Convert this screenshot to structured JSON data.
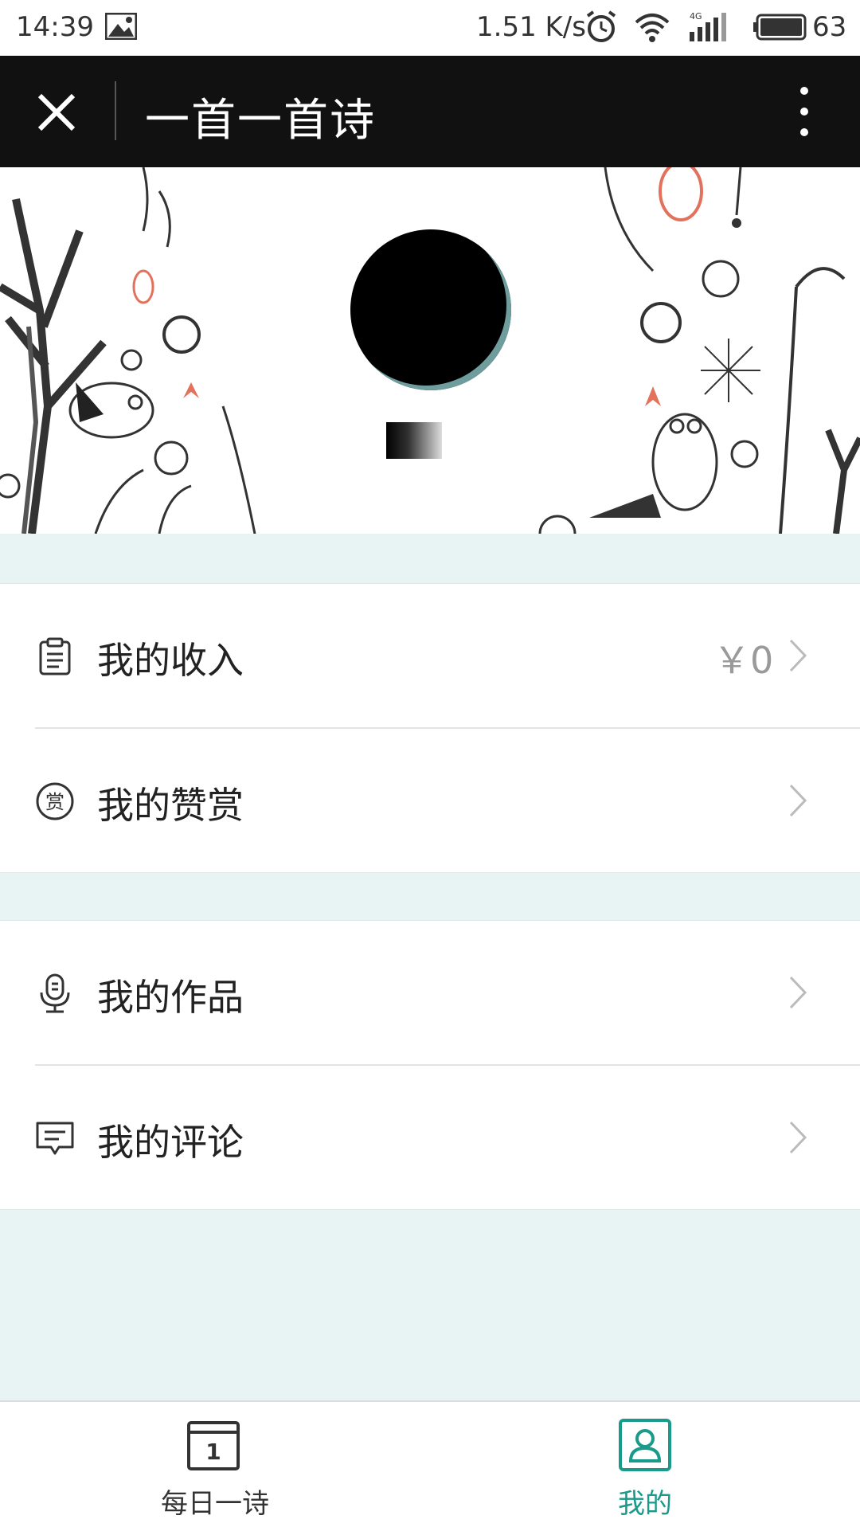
{
  "status_bar": {
    "time": "14:39",
    "speed": "1.51 K/s",
    "battery": "63",
    "network": "4G"
  },
  "title_bar": {
    "title": "一首一首诗"
  },
  "menu": {
    "group1": [
      {
        "label": "我的收入",
        "value": "￥0",
        "icon": "clipboard-icon"
      },
      {
        "label": "我的赞赏",
        "value": "",
        "icon": "reward-icon"
      }
    ],
    "group2": [
      {
        "label": "我的作品",
        "value": "",
        "icon": "microphone-icon"
      },
      {
        "label": "我的评论",
        "value": "",
        "icon": "comment-icon"
      }
    ]
  },
  "tabs": [
    {
      "label": "每日一诗",
      "icon": "calendar-icon",
      "calendar_day": "1",
      "active": false
    },
    {
      "label": "我的",
      "icon": "user-icon",
      "active": true
    }
  ],
  "colors": {
    "accent": "#1a9a8a",
    "background": "#e8f3f3",
    "titlebar": "#111111"
  }
}
